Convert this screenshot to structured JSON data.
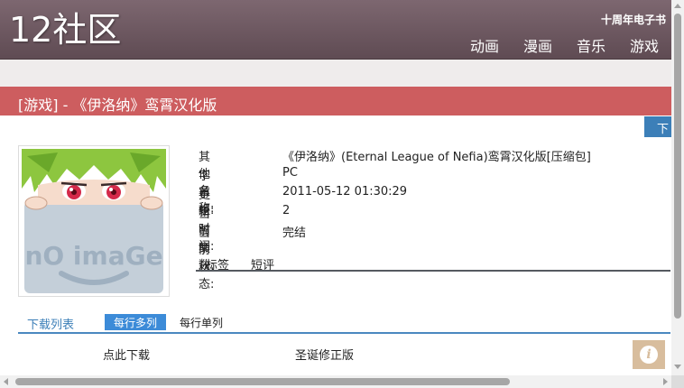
{
  "header": {
    "logo": "12社区",
    "tagline": "十周年电子书",
    "nav": [
      "动画",
      "漫画",
      "音乐",
      "游戏"
    ]
  },
  "title": "[游戏] - 《伊洛纳》鸾霄汉化版",
  "download_tab": "下",
  "cover": {
    "text": "nO imaGe",
    "icon": "no-image-placeholder"
  },
  "info": [
    {
      "key": "其他名称:",
      "value": "《伊洛纳》(Eternal League of Nefia)鸾霄汉化版[压缩包]"
    },
    {
      "key": "字幕组:",
      "value": "PC"
    },
    {
      "key": "更新时间:",
      "value": "2011-05-12 01:30:29"
    },
    {
      "key": "当前集数:",
      "value": "2"
    },
    {
      "key": "当前状态:",
      "value": "完结"
    }
  ],
  "tabs": [
    "标签",
    "短评"
  ],
  "download": {
    "label": "下载列表",
    "view_multi": "每行多列",
    "view_single": "每行单列",
    "rows": [
      {
        "link": "点此下载",
        "name": "圣诞修正版"
      }
    ]
  },
  "colors": {
    "header": "#6f5a62",
    "title_bar": "#cd5d5f",
    "accent_blue": "#3c7fb8",
    "info_button": "#d8bd9d"
  }
}
